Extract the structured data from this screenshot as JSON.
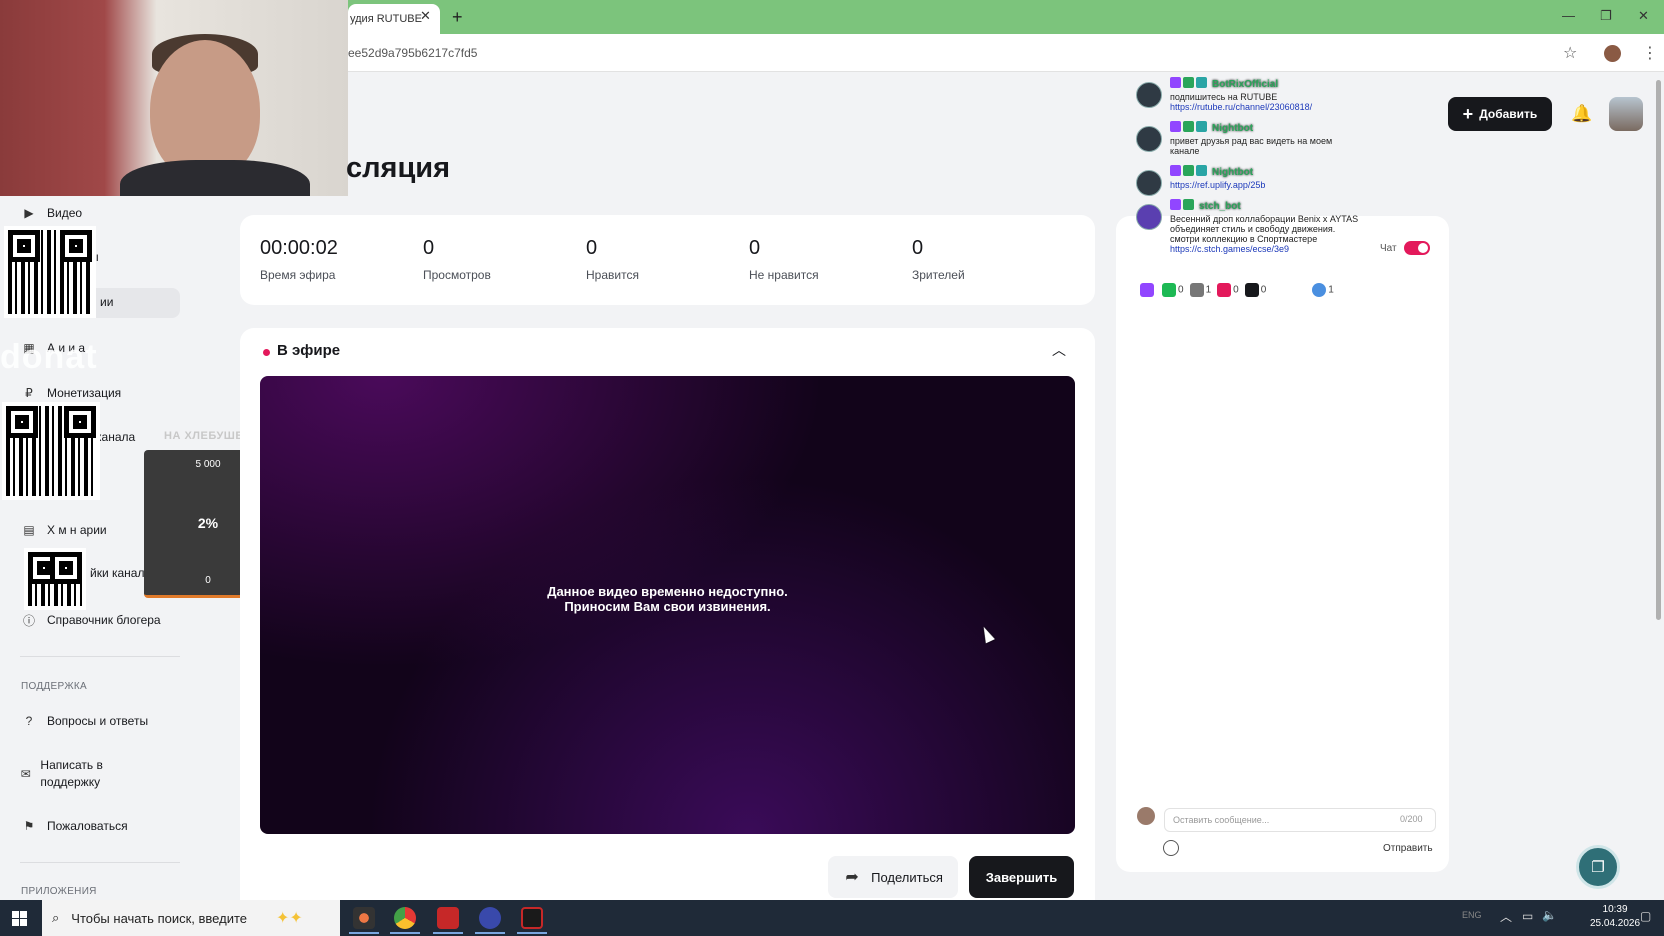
{
  "browser": {
    "tab_title": "удия RUTUBE",
    "url": "ee52d9a795b6217c7fd5"
  },
  "sidebar": {
    "items": [
      {
        "label": "Видео",
        "icon": "video-icon"
      },
      {
        "label": "ы",
        "icon": "playlist-icon"
      },
      {
        "label": "ии",
        "icon": "broadcast-icon"
      },
      {
        "label": "А  и  и а",
        "icon": "analytics-icon"
      },
      {
        "label": "Монетизация",
        "icon": "monetization-icon"
      },
      {
        "label": "канала",
        "icon": "channel-icon"
      },
      {
        "label": "Х м  н арии",
        "icon": "comments-icon"
      },
      {
        "label": "йки канал",
        "icon": "settings-icon"
      },
      {
        "label": "Справочник блогера",
        "icon": "info-icon"
      }
    ],
    "support_label": "ПОДДЕРЖКА",
    "support_items": [
      {
        "label": "Вопросы и ответы",
        "icon": "question-icon"
      },
      {
        "label": "Написать в поддержку",
        "icon": "mail-icon"
      },
      {
        "label": "Пожаловаться",
        "icon": "flag-icon"
      }
    ],
    "apps_label": "ПРИЛОЖЕНИЯ"
  },
  "overlays": {
    "ghost_text": "donat",
    "goal": {
      "title": "НА ХЛЕБУШЕК",
      "top": "5 000",
      "percent": "2%",
      "bottom": "0",
      "progress": 0.02
    }
  },
  "main": {
    "page_title": "сляция",
    "stats": [
      {
        "value": "00:00:02",
        "label": "Время эфира"
      },
      {
        "value": "0",
        "label": "Просмотров"
      },
      {
        "value": "0",
        "label": "Нравится"
      },
      {
        "value": "0",
        "label": "Не нравится"
      },
      {
        "value": "0",
        "label": "Зрителей"
      }
    ],
    "live_label": "В эфире",
    "player_message_1": "Данное видео временно недоступно.",
    "player_message_2": "Приносим Вам свои извинения.",
    "share_label": "Поделиться",
    "end_label": "Завершить"
  },
  "header": {
    "add_label": "Добавить"
  },
  "chat": {
    "toggle_label": "Чат",
    "messages": [
      {
        "author": "BotRixOfficial",
        "text": "подпишитесь на RUTUBE ",
        "link": "https://rutube.ru/channel/23060818/"
      },
      {
        "author": "Nightbot",
        "text": "привет друзья рад вас видеть на моем канале",
        "link": ""
      },
      {
        "author": "Nightbot",
        "text": "",
        "link": "https://ref.uplify.app/25b"
      },
      {
        "author": "stch_bot",
        "text": "Весенний дроп коллаборации Benix х AYTAS объединяет стиль и свободу движения. смотри коллекцию в Спортмастере ",
        "link": "https://c.stch.games/ecse/3e9"
      }
    ],
    "stats": [
      {
        "icon": "twitch-icon",
        "value": ""
      },
      {
        "icon": "trovo-icon",
        "value": "0"
      },
      {
        "icon": "goodgame-icon",
        "value": "1"
      },
      {
        "icon": "vklive-icon",
        "value": "0"
      },
      {
        "icon": "rutube-icon",
        "value": "0"
      },
      {
        "icon": "viewers-icon",
        "value": "1"
      }
    ],
    "input_placeholder": "Оставить сообщение...",
    "counter": "0/200",
    "send_label": "Отправить"
  },
  "taskbar": {
    "search_placeholder": "Чтобы начать поиск, введите",
    "lang": "ENG",
    "time": "10:39",
    "date": "25.04.2026"
  },
  "colors": {
    "accent": "#e3195b",
    "tabbar": "#7cc47c",
    "dark_button": "#17181c"
  }
}
